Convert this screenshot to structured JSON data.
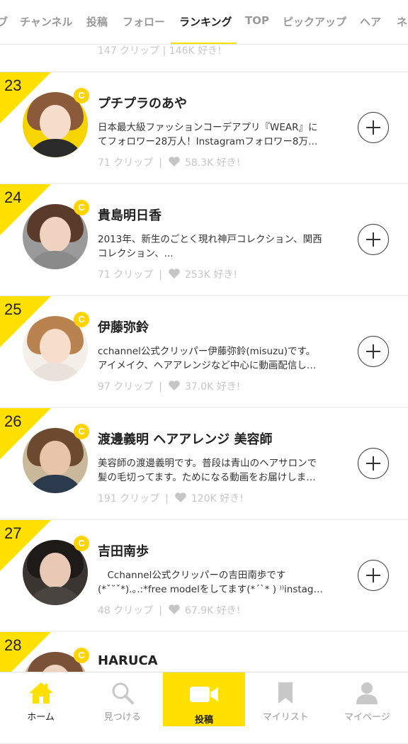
{
  "tabs": [
    {
      "label": "ブ"
    },
    {
      "label": "チャンネル"
    },
    {
      "label": "投稿"
    },
    {
      "label": "フォロー"
    },
    {
      "label": "ランキング"
    },
    {
      "label": "TOP"
    },
    {
      "label": "ピックアップ"
    },
    {
      "label": "ヘア"
    },
    {
      "label": "ネ"
    }
  ],
  "active_tab": "ランキング",
  "partial_card": {
    "stats": "147 クリップ  |  146K 好き!"
  },
  "cards": [
    {
      "rank": "23",
      "name": "プチプラのあや",
      "desc": "日本最大級ファッションコーデアプリ『WEAR』に\nてフォロワー28万人！Instagramフォロワー8万…",
      "clips": "71 クリップ",
      "likes": "58.3K 好き!"
    },
    {
      "rank": "24",
      "name": "貴島明日香",
      "desc": "2013年、新生のごとく現れ神戸コレクション、関西\nコレクション、...",
      "clips": "71 クリップ",
      "likes": "253K 好き!"
    },
    {
      "rank": "25",
      "name": "伊藤弥鈴",
      "desc": "cchannel公式クリッパー伊藤弥鈴(misuzu)です。\nアイメイク、ヘアアレンジなど中心に動画配信し…",
      "clips": "97 クリップ",
      "likes": "37.0K 好き!"
    },
    {
      "rank": "26",
      "name": "渡邊義明 ヘアアレンジ 美容師",
      "desc": "美容師の渡邊義明です。普段は青山のヘアサロンで\n髪の毛切ってます。ためになる動画をお届けしま…",
      "clips": "191 クリップ",
      "likes": "120K 好き!"
    },
    {
      "rank": "27",
      "name": "吉田南歩",
      "desc": "　Cchannel公式クリッパーの吉田南歩です\n(*ˇ˘ˇ*).｡.:*free modelをしてます(*ˊˋ*  ) ⁾⁾instag…",
      "clips": "48 クリップ",
      "likes": "67.9K 好き!"
    },
    {
      "rank": "28",
      "name": "HARUCA",
      "desc": "",
      "clips": "",
      "likes": ""
    }
  ],
  "badge_letter": "C",
  "separator": "|",
  "bottom_nav": [
    {
      "label": "ホーム",
      "icon": "home-icon"
    },
    {
      "label": "見つける",
      "icon": "search-icon"
    },
    {
      "label": "投稿",
      "icon": "video-camera-icon"
    },
    {
      "label": "マイリスト",
      "icon": "bookmark-icon"
    },
    {
      "label": "マイページ",
      "icon": "person-icon"
    }
  ],
  "colors": {
    "accent": "#ffe000",
    "badge": "#ffd400",
    "muted": "#c6c6c6"
  }
}
